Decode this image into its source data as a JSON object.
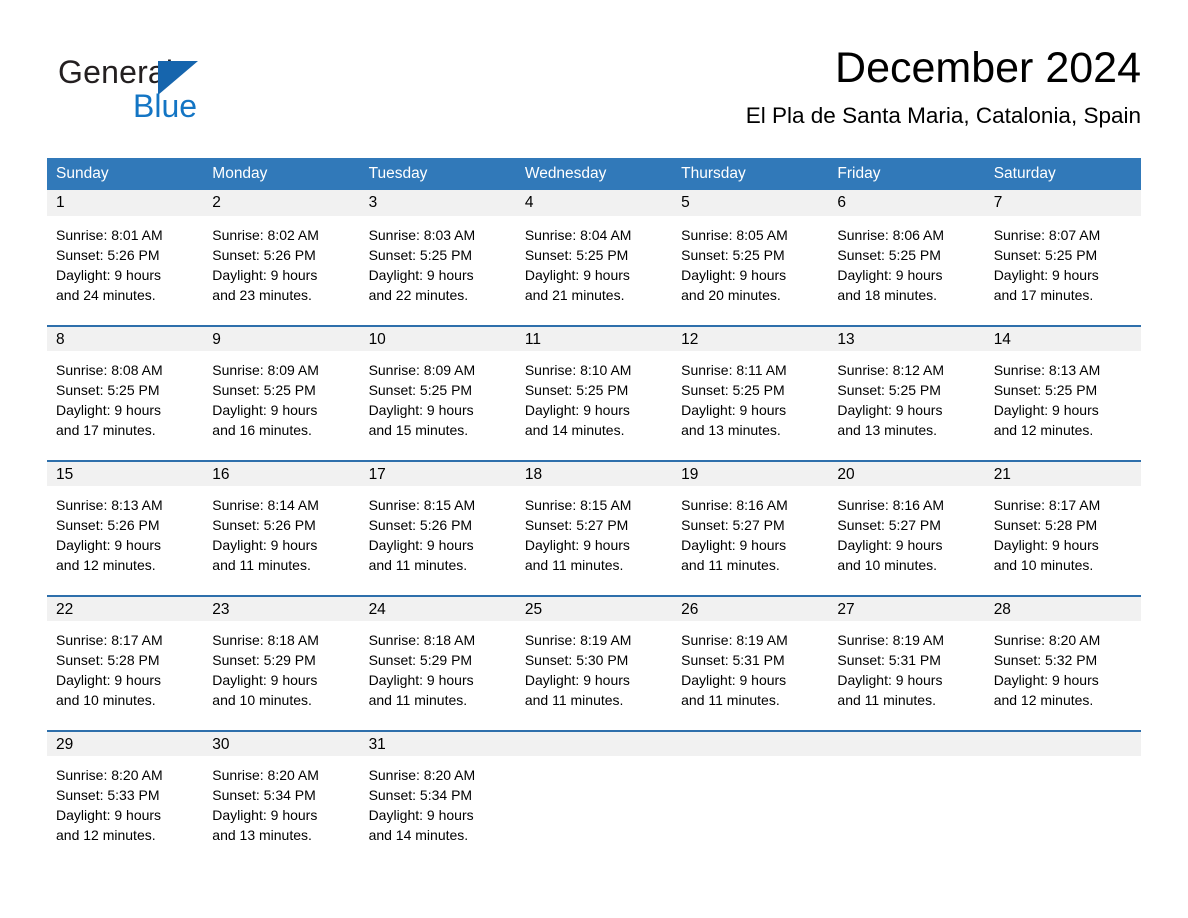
{
  "brand": {
    "logo_text_general": "General",
    "logo_text_blue": "Blue",
    "accent_blue": "#3179b9",
    "logo_blue": "#1375c4",
    "header_band_blue": "#3179b9",
    "row_separator_blue": "#2e6fab",
    "daynum_band_gray": "#f1f1f1"
  },
  "header": {
    "title": "December 2024",
    "subtitle": "El Pla de Santa Maria, Catalonia, Spain"
  },
  "calendar": {
    "weekday_headers": [
      "Sunday",
      "Monday",
      "Tuesday",
      "Wednesday",
      "Thursday",
      "Friday",
      "Saturday"
    ],
    "weeks": [
      [
        {
          "day": "1",
          "sunrise": "Sunrise: 8:01 AM",
          "sunset": "Sunset: 5:26 PM",
          "daylight_line1": "Daylight: 9 hours",
          "daylight_line2": "and 24 minutes."
        },
        {
          "day": "2",
          "sunrise": "Sunrise: 8:02 AM",
          "sunset": "Sunset: 5:26 PM",
          "daylight_line1": "Daylight: 9 hours",
          "daylight_line2": "and 23 minutes."
        },
        {
          "day": "3",
          "sunrise": "Sunrise: 8:03 AM",
          "sunset": "Sunset: 5:25 PM",
          "daylight_line1": "Daylight: 9 hours",
          "daylight_line2": "and 22 minutes."
        },
        {
          "day": "4",
          "sunrise": "Sunrise: 8:04 AM",
          "sunset": "Sunset: 5:25 PM",
          "daylight_line1": "Daylight: 9 hours",
          "daylight_line2": "and 21 minutes."
        },
        {
          "day": "5",
          "sunrise": "Sunrise: 8:05 AM",
          "sunset": "Sunset: 5:25 PM",
          "daylight_line1": "Daylight: 9 hours",
          "daylight_line2": "and 20 minutes."
        },
        {
          "day": "6",
          "sunrise": "Sunrise: 8:06 AM",
          "sunset": "Sunset: 5:25 PM",
          "daylight_line1": "Daylight: 9 hours",
          "daylight_line2": "and 18 minutes."
        },
        {
          "day": "7",
          "sunrise": "Sunrise: 8:07 AM",
          "sunset": "Sunset: 5:25 PM",
          "daylight_line1": "Daylight: 9 hours",
          "daylight_line2": "and 17 minutes."
        }
      ],
      [
        {
          "day": "8",
          "sunrise": "Sunrise: 8:08 AM",
          "sunset": "Sunset: 5:25 PM",
          "daylight_line1": "Daylight: 9 hours",
          "daylight_line2": "and 17 minutes."
        },
        {
          "day": "9",
          "sunrise": "Sunrise: 8:09 AM",
          "sunset": "Sunset: 5:25 PM",
          "daylight_line1": "Daylight: 9 hours",
          "daylight_line2": "and 16 minutes."
        },
        {
          "day": "10",
          "sunrise": "Sunrise: 8:09 AM",
          "sunset": "Sunset: 5:25 PM",
          "daylight_line1": "Daylight: 9 hours",
          "daylight_line2": "and 15 minutes."
        },
        {
          "day": "11",
          "sunrise": "Sunrise: 8:10 AM",
          "sunset": "Sunset: 5:25 PM",
          "daylight_line1": "Daylight: 9 hours",
          "daylight_line2": "and 14 minutes."
        },
        {
          "day": "12",
          "sunrise": "Sunrise: 8:11 AM",
          "sunset": "Sunset: 5:25 PM",
          "daylight_line1": "Daylight: 9 hours",
          "daylight_line2": "and 13 minutes."
        },
        {
          "day": "13",
          "sunrise": "Sunrise: 8:12 AM",
          "sunset": "Sunset: 5:25 PM",
          "daylight_line1": "Daylight: 9 hours",
          "daylight_line2": "and 13 minutes."
        },
        {
          "day": "14",
          "sunrise": "Sunrise: 8:13 AM",
          "sunset": "Sunset: 5:25 PM",
          "daylight_line1": "Daylight: 9 hours",
          "daylight_line2": "and 12 minutes."
        }
      ],
      [
        {
          "day": "15",
          "sunrise": "Sunrise: 8:13 AM",
          "sunset": "Sunset: 5:26 PM",
          "daylight_line1": "Daylight: 9 hours",
          "daylight_line2": "and 12 minutes."
        },
        {
          "day": "16",
          "sunrise": "Sunrise: 8:14 AM",
          "sunset": "Sunset: 5:26 PM",
          "daylight_line1": "Daylight: 9 hours",
          "daylight_line2": "and 11 minutes."
        },
        {
          "day": "17",
          "sunrise": "Sunrise: 8:15 AM",
          "sunset": "Sunset: 5:26 PM",
          "daylight_line1": "Daylight: 9 hours",
          "daylight_line2": "and 11 minutes."
        },
        {
          "day": "18",
          "sunrise": "Sunrise: 8:15 AM",
          "sunset": "Sunset: 5:27 PM",
          "daylight_line1": "Daylight: 9 hours",
          "daylight_line2": "and 11 minutes."
        },
        {
          "day": "19",
          "sunrise": "Sunrise: 8:16 AM",
          "sunset": "Sunset: 5:27 PM",
          "daylight_line1": "Daylight: 9 hours",
          "daylight_line2": "and 11 minutes."
        },
        {
          "day": "20",
          "sunrise": "Sunrise: 8:16 AM",
          "sunset": "Sunset: 5:27 PM",
          "daylight_line1": "Daylight: 9 hours",
          "daylight_line2": "and 10 minutes."
        },
        {
          "day": "21",
          "sunrise": "Sunrise: 8:17 AM",
          "sunset": "Sunset: 5:28 PM",
          "daylight_line1": "Daylight: 9 hours",
          "daylight_line2": "and 10 minutes."
        }
      ],
      [
        {
          "day": "22",
          "sunrise": "Sunrise: 8:17 AM",
          "sunset": "Sunset: 5:28 PM",
          "daylight_line1": "Daylight: 9 hours",
          "daylight_line2": "and 10 minutes."
        },
        {
          "day": "23",
          "sunrise": "Sunrise: 8:18 AM",
          "sunset": "Sunset: 5:29 PM",
          "daylight_line1": "Daylight: 9 hours",
          "daylight_line2": "and 10 minutes."
        },
        {
          "day": "24",
          "sunrise": "Sunrise: 8:18 AM",
          "sunset": "Sunset: 5:29 PM",
          "daylight_line1": "Daylight: 9 hours",
          "daylight_line2": "and 11 minutes."
        },
        {
          "day": "25",
          "sunrise": "Sunrise: 8:19 AM",
          "sunset": "Sunset: 5:30 PM",
          "daylight_line1": "Daylight: 9 hours",
          "daylight_line2": "and 11 minutes."
        },
        {
          "day": "26",
          "sunrise": "Sunrise: 8:19 AM",
          "sunset": "Sunset: 5:31 PM",
          "daylight_line1": "Daylight: 9 hours",
          "daylight_line2": "and 11 minutes."
        },
        {
          "day": "27",
          "sunrise": "Sunrise: 8:19 AM",
          "sunset": "Sunset: 5:31 PM",
          "daylight_line1": "Daylight: 9 hours",
          "daylight_line2": "and 11 minutes."
        },
        {
          "day": "28",
          "sunrise": "Sunrise: 8:20 AM",
          "sunset": "Sunset: 5:32 PM",
          "daylight_line1": "Daylight: 9 hours",
          "daylight_line2": "and 12 minutes."
        }
      ],
      [
        {
          "day": "29",
          "sunrise": "Sunrise: 8:20 AM",
          "sunset": "Sunset: 5:33 PM",
          "daylight_line1": "Daylight: 9 hours",
          "daylight_line2": "and 12 minutes."
        },
        {
          "day": "30",
          "sunrise": "Sunrise: 8:20 AM",
          "sunset": "Sunset: 5:34 PM",
          "daylight_line1": "Daylight: 9 hours",
          "daylight_line2": "and 13 minutes."
        },
        {
          "day": "31",
          "sunrise": "Sunrise: 8:20 AM",
          "sunset": "Sunset: 5:34 PM",
          "daylight_line1": "Daylight: 9 hours",
          "daylight_line2": "and 14 minutes."
        },
        {
          "day": "",
          "sunrise": "",
          "sunset": "",
          "daylight_line1": "",
          "daylight_line2": ""
        },
        {
          "day": "",
          "sunrise": "",
          "sunset": "",
          "daylight_line1": "",
          "daylight_line2": ""
        },
        {
          "day": "",
          "sunrise": "",
          "sunset": "",
          "daylight_line1": "",
          "daylight_line2": ""
        },
        {
          "day": "",
          "sunrise": "",
          "sunset": "",
          "daylight_line1": "",
          "daylight_line2": ""
        }
      ]
    ]
  }
}
